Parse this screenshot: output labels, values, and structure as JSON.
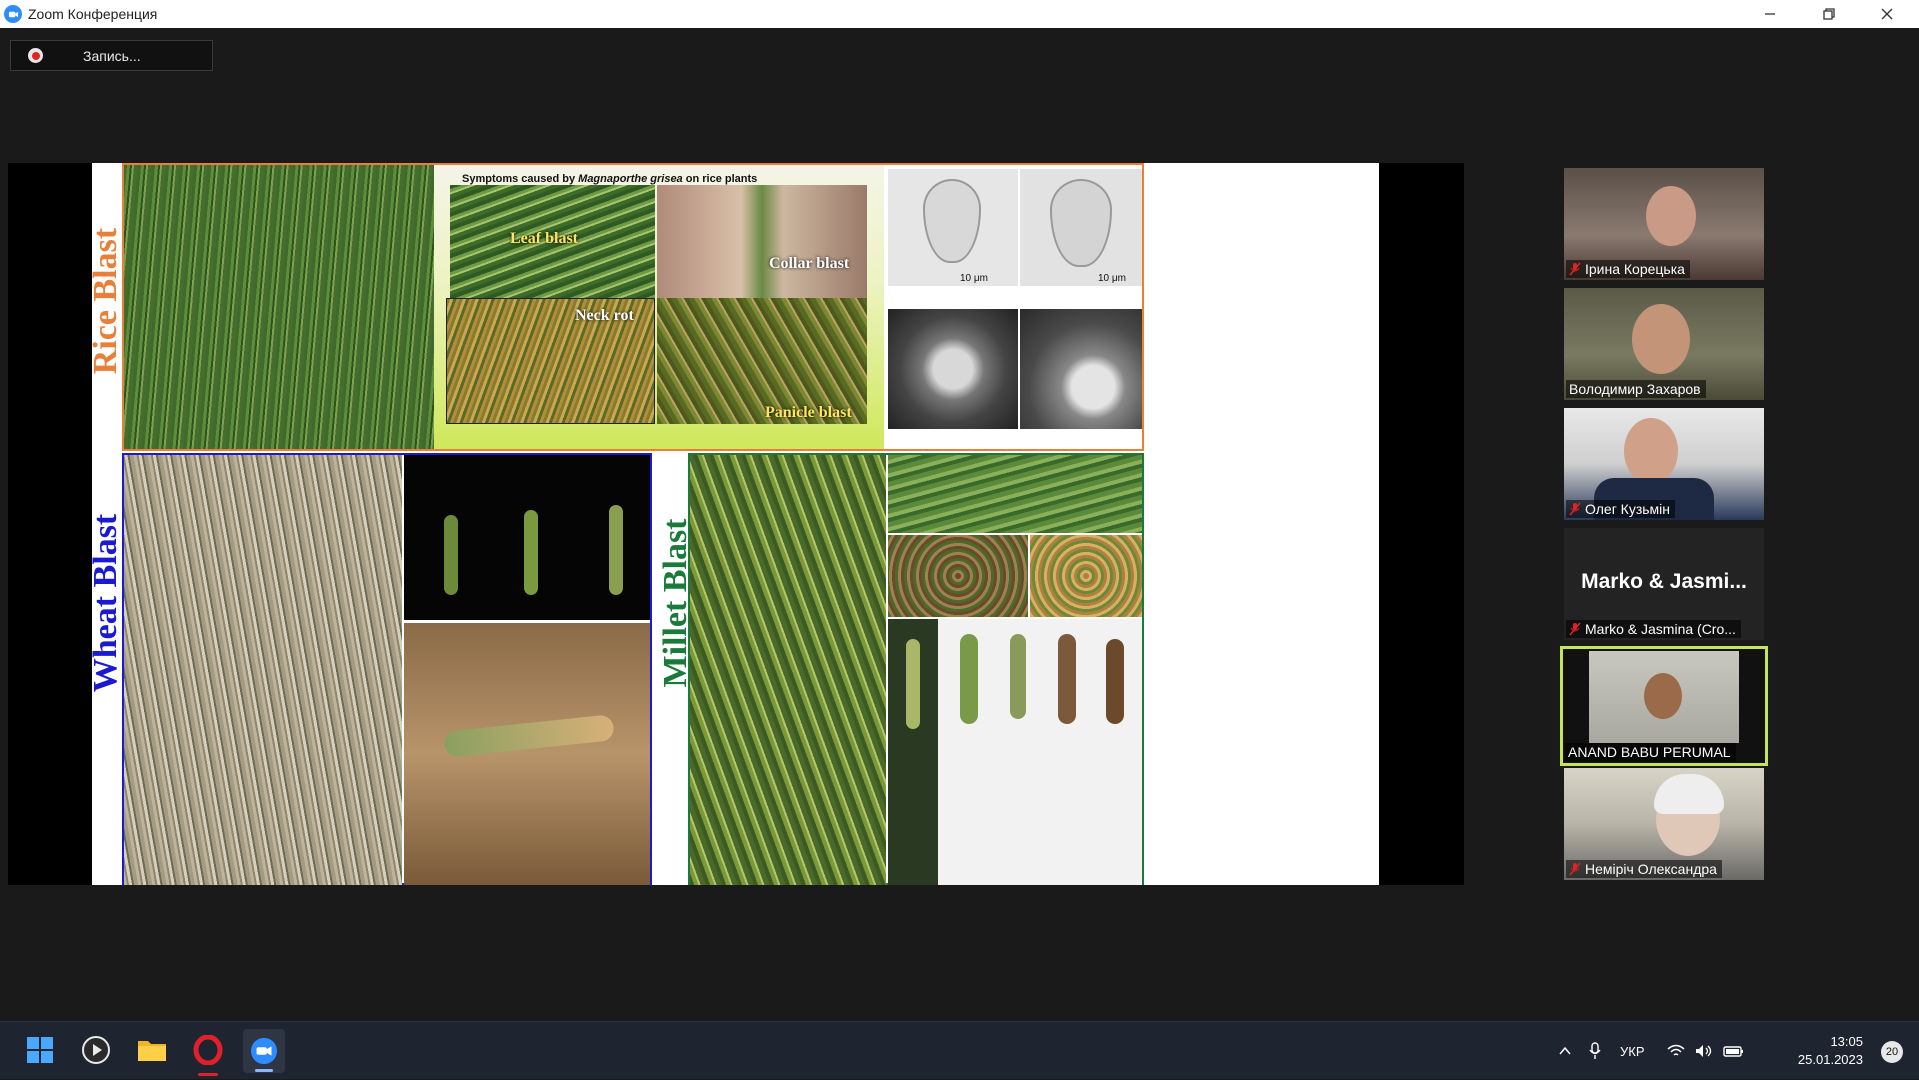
{
  "window": {
    "title": "Zoom Конференция"
  },
  "recording": {
    "label": "Запись..."
  },
  "slide": {
    "heading_prefix": "Symptoms caused by ",
    "heading_italic": "Magnaporthe grisea",
    "heading_suffix": " on rice plants",
    "sections": {
      "rice": "Rice Blast",
      "wheat": "Wheat Blast",
      "millet": "Millet Blast"
    },
    "captions": {
      "leaf": "Leaf blast",
      "collar": "Collar blast",
      "neck": "Neck rot",
      "panicle": "Panicle blast"
    },
    "scale_bars": [
      "10 μm",
      "10 μm"
    ],
    "colors": {
      "rice": "#e8803a",
      "wheat": "#1a1ad0",
      "millet": "#1a7a3a"
    }
  },
  "participants": [
    {
      "name": "Ірина Корецька",
      "muted": true,
      "video": true
    },
    {
      "name": "Володимир Захаров",
      "muted": false,
      "video": true
    },
    {
      "name": "Олег Кузьмін",
      "muted": true,
      "video": true
    },
    {
      "name": "Marko & Jasmina (Cro...",
      "display": "Marko & Jasmi...",
      "muted": true,
      "video": false
    },
    {
      "name": "ANAND BABU PERUMAL",
      "muted": false,
      "video": true,
      "active_speaker": true
    },
    {
      "name": "Немірiч Олександра",
      "muted": true,
      "video": true
    }
  ],
  "taskbar": {
    "apps": [
      "start-icon",
      "media-player-icon",
      "file-explorer-icon",
      "opera-icon",
      "zoom-icon"
    ],
    "language": "УКР",
    "time": "13:05",
    "date": "25.01.2023",
    "notifications": "20"
  }
}
